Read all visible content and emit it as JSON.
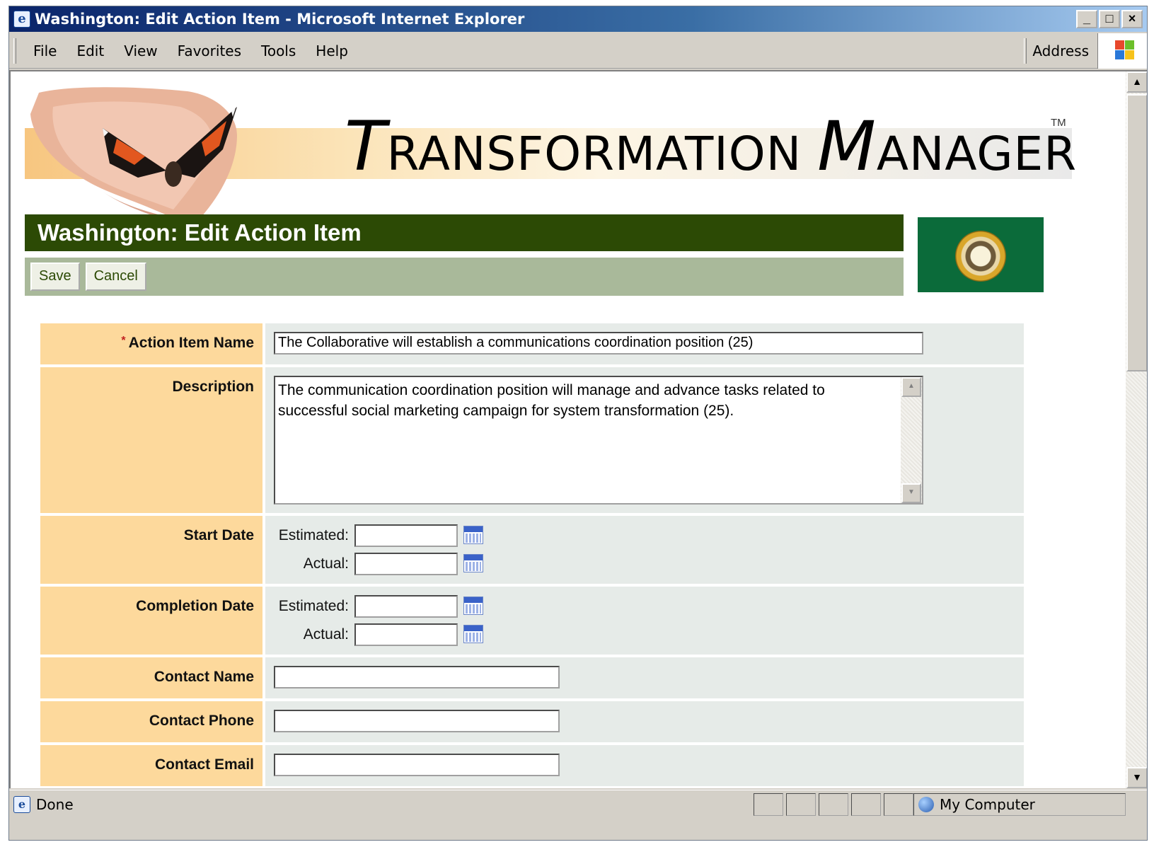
{
  "window": {
    "title": "Washington: Edit Action Item - Microsoft Internet Explorer",
    "buttons": {
      "minimize": "_",
      "maximize": "□",
      "close": "×"
    }
  },
  "menu": {
    "items": [
      {
        "label": "File"
      },
      {
        "label": "Edit"
      },
      {
        "label": "View"
      },
      {
        "label": "Favorites"
      },
      {
        "label": "Tools"
      },
      {
        "label": "Help"
      }
    ],
    "address_label": "Address"
  },
  "banner": {
    "brand_t": "T",
    "brand_ransformation": "RANSFORMATION ",
    "brand_m": "M",
    "brand_anager": "ANAGER",
    "trademark": "TM"
  },
  "page": {
    "title": "Washington: Edit Action Item",
    "save_label": "Save",
    "cancel_label": "Cancel"
  },
  "form": {
    "required_mark": "*",
    "action_item_name": {
      "label": "Action Item Name",
      "value": "The Collaborative will establish a communications coordination position (25)"
    },
    "description": {
      "label": "Description",
      "value": "The communication coordination position will manage and advance tasks related to successful social marketing campaign for system transformation (25)."
    },
    "start_date": {
      "label": "Start Date",
      "estimated_label": "Estimated:",
      "actual_label": "Actual:",
      "estimated": "",
      "actual": ""
    },
    "completion_date": {
      "label": "Completion Date",
      "estimated_label": "Estimated:",
      "actual_label": "Actual:",
      "estimated": "",
      "actual": ""
    },
    "contact_name": {
      "label": "Contact Name",
      "value": ""
    },
    "contact_phone": {
      "label": "Contact Phone",
      "value": ""
    },
    "contact_email": {
      "label": "Contact Email",
      "value": ""
    }
  },
  "status": {
    "text": "Done",
    "zone": "My Computer"
  },
  "colors": {
    "title_bar": "#2c4a05",
    "action_bar": "#a9b99a",
    "label_bg": "#fdd99c",
    "value_bg": "#e6ebe8",
    "flag_green": "#0b6b3a"
  }
}
